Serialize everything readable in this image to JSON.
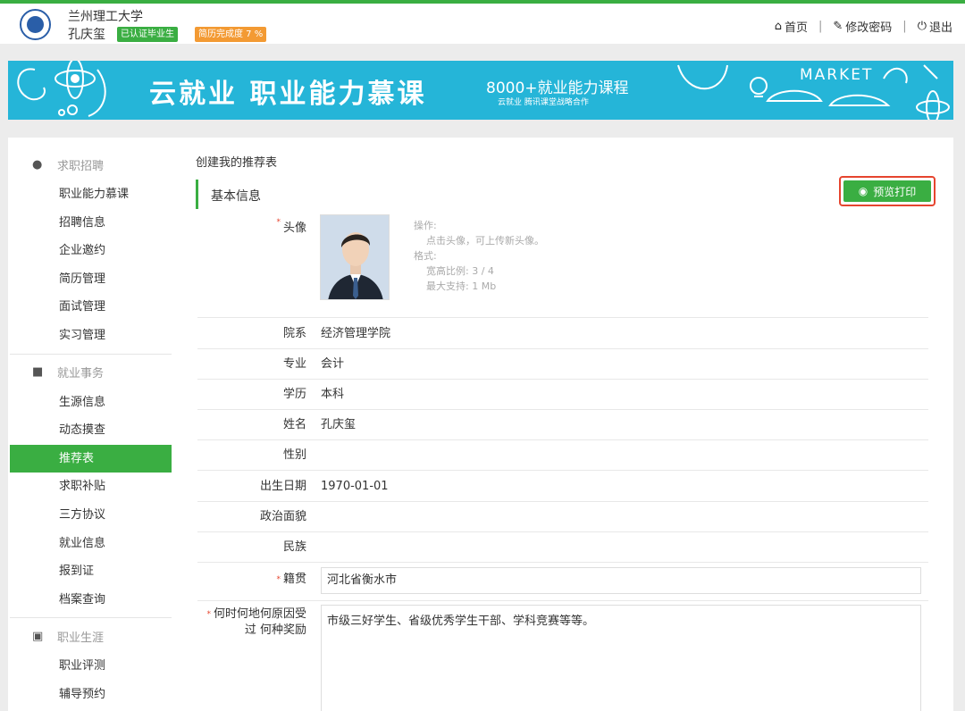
{
  "header": {
    "university": "兰州理工大学",
    "user_name": "孔庆玺",
    "badge_verified": "已认证毕业生",
    "badge_resume": "简历完成度 7 %",
    "links": {
      "home": "首页",
      "change_password": "修改密码",
      "logout": "退出"
    },
    "colors": {
      "accent": "#3aae42",
      "badge_orange": "#f39a33"
    }
  },
  "banner": {
    "title": "云就业  职业能力慕课",
    "sub1": "8000+就业能力课程",
    "sub2": "云就业 腾讯课堂战略合作",
    "market": "MARKET",
    "color": "#25b5d8"
  },
  "sidebar": {
    "sections": [
      {
        "title": "求职招聘",
        "icon": "person-icon",
        "items": [
          "职业能力慕课",
          "招聘信息",
          "企业邀约",
          "简历管理",
          "面试管理",
          "实习管理"
        ]
      },
      {
        "title": "就业事务",
        "icon": "folder-icon",
        "items": [
          "生源信息",
          "动态摸查",
          "推荐表",
          "求职补贴",
          "三方协议",
          "就业信息",
          "报到证",
          "档案查询"
        ]
      },
      {
        "title": "职业生涯",
        "icon": "briefcase-icon",
        "items": [
          "职业评测",
          "辅导预约"
        ]
      }
    ],
    "active_item": "推荐表"
  },
  "content": {
    "breadcrumb": "创建我的推荐表",
    "section_title": "基本信息",
    "print_button": "预览打印",
    "avatar": {
      "label": "头像",
      "hint_title": "操作:",
      "hint_op": "点击头像，可上传新头像。",
      "hint_format": "格式:",
      "hint_ratio": "宽高比例: 3 / 4",
      "hint_size": "最大支持: 1 Mb"
    },
    "fields": [
      {
        "label": "院系",
        "value": "经济管理学院"
      },
      {
        "label": "专业",
        "value": "会计"
      },
      {
        "label": "学历",
        "value": "本科"
      },
      {
        "label": "姓名",
        "value": "孔庆玺"
      },
      {
        "label": "性别",
        "value": ""
      },
      {
        "label": "出生日期",
        "value": "1970-01-01"
      },
      {
        "label": "政治面貌",
        "value": ""
      },
      {
        "label": "民族",
        "value": ""
      }
    ],
    "native_place": {
      "label": "籍贯",
      "value": "河北省衡水市"
    },
    "awards": {
      "label_line1": "何时何地何原因受",
      "label_line2": "过 何种奖励",
      "value": "市级三好学生、省级优秀学生干部、学科竞赛等等。"
    }
  }
}
